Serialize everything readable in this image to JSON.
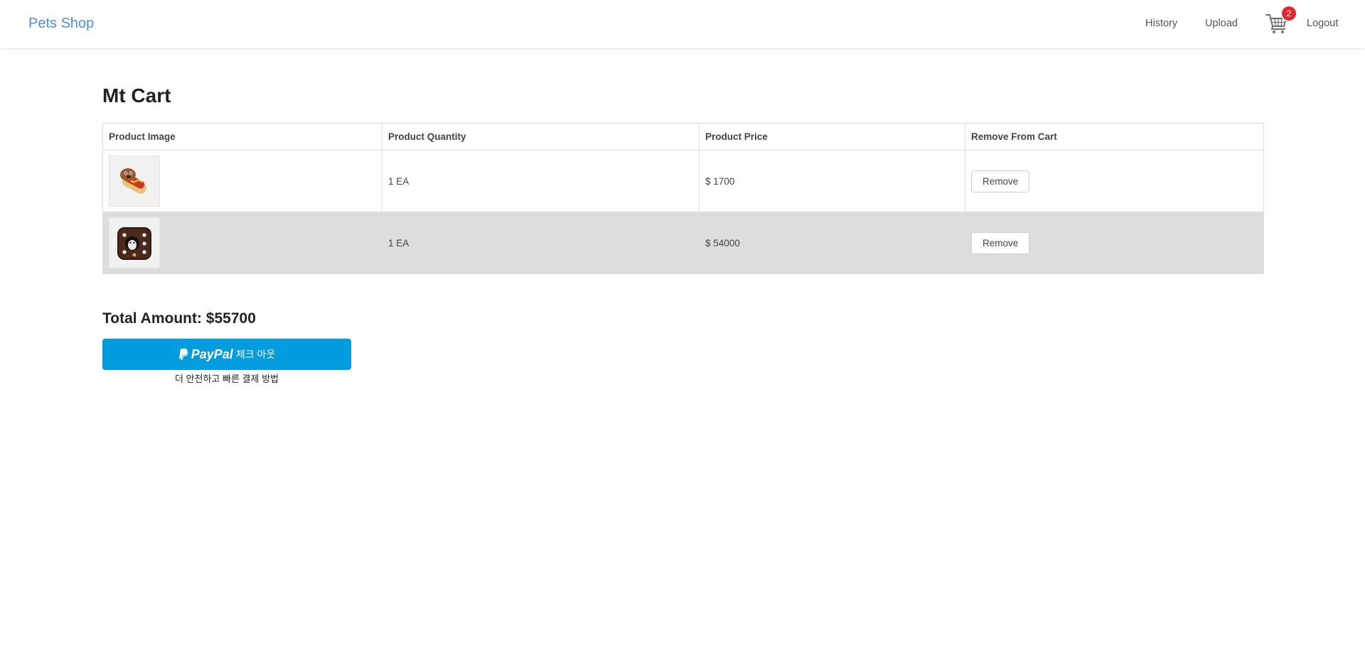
{
  "navbar": {
    "brand": "Pets Shop",
    "links": {
      "history": "History",
      "upload": "Upload",
      "logout": "Logout"
    },
    "cart_count": "2",
    "brand_color": "#4a90d9",
    "badge_color": "#e5262f"
  },
  "page": {
    "title": "Mt Cart"
  },
  "table": {
    "headers": [
      "Product Image",
      "Product Quantity",
      "Product Price",
      "Remove From Cart"
    ],
    "rows": [
      {
        "image_icon": "hotdog-toy-image",
        "quantity": "1 EA",
        "price": "$ 1700",
        "action": "Remove"
      },
      {
        "image_icon": "dice-pet-house-image",
        "quantity": "1 EA",
        "price": "$ 54000",
        "action": "Remove"
      }
    ],
    "alt_row_color": "#dddddd"
  },
  "summary": {
    "total": "Total Amount: $55700"
  },
  "paypal": {
    "logo_text": "PayPal",
    "button_text": "체크 아웃",
    "tagline": "더 안전하고 빠른 결제 방법",
    "button_color": "#009cde"
  }
}
